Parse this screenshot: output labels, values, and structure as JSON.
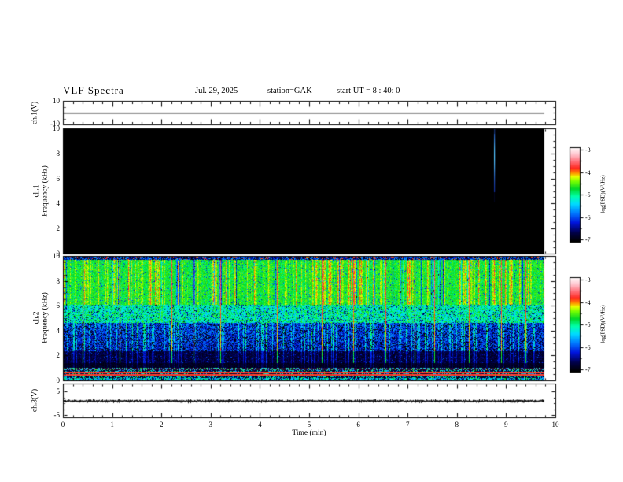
{
  "title": {
    "main": "VLF Spectra",
    "date": "Jul. 29, 2025",
    "station": "station=GAK",
    "start_ut": "start UT =  8 : 40: 0"
  },
  "x_axis": {
    "label": "Time (min)",
    "tick_labels": [
      "0",
      "1",
      "2",
      "3",
      "4",
      "5",
      "6",
      "7",
      "8",
      "9",
      "10"
    ],
    "range_min": [
      0,
      10
    ],
    "minor_step_min": 0.2,
    "data_end_min": 9.78
  },
  "colorbar": {
    "label": "log(PSD)(V²/Hz)",
    "tick_labels": [
      "-3",
      "-4",
      "-5",
      "-6",
      "-7"
    ],
    "range": [
      -7,
      -3
    ],
    "minor_step": 0.5,
    "colormap_stops": [
      [
        0.0,
        0,
        0,
        0
      ],
      [
        0.09,
        0,
        0,
        70
      ],
      [
        0.2,
        0,
        20,
        220
      ],
      [
        0.3,
        0,
        120,
        255
      ],
      [
        0.4,
        0,
        220,
        255
      ],
      [
        0.48,
        0,
        255,
        170
      ],
      [
        0.56,
        0,
        215,
        40
      ],
      [
        0.64,
        120,
        255,
        0
      ],
      [
        0.69,
        235,
        255,
        0
      ],
      [
        0.73,
        255,
        140,
        0
      ],
      [
        0.78,
        255,
        40,
        30
      ],
      [
        0.85,
        255,
        110,
        120
      ],
      [
        0.92,
        255,
        190,
        200
      ],
      [
        1.0,
        255,
        255,
        255
      ]
    ]
  },
  "chart_data": [
    {
      "id": "ch1_waveform",
      "type": "line",
      "ylabel": "ch.1(V)",
      "ylim_v": [
        -10,
        10
      ],
      "ytick_labels": [
        "10",
        "-10"
      ],
      "x_range_min": [
        0,
        9.78
      ],
      "signal": {
        "shape": "flat",
        "mean_v": 0,
        "color": "#3f3f3f"
      }
    },
    {
      "id": "ch1_spectrogram",
      "type": "heatmap",
      "ylabel_lines": [
        "ch.1",
        "Frequency (kHz)"
      ],
      "ylim_khz": [
        0,
        10
      ],
      "ytick_labels": [
        "10",
        "8",
        "6",
        "4",
        "2",
        "0"
      ],
      "ytick_minor_khz": 0.5,
      "background_log_psd": -7,
      "features": [
        {
          "type": "vertical_burst",
          "time_min": 8.75,
          "freq_span_khz": [
            5.0,
            10
          ],
          "peak_freq_khz": 7.8,
          "faint_tail_khz": [
            4.2,
            5.0
          ],
          "color": "blue-cyan"
        }
      ]
    },
    {
      "id": "ch2_spectrogram",
      "type": "heatmap",
      "ylabel_lines": [
        "ch.2",
        "Frequency (kHz)"
      ],
      "ylim_khz": [
        0,
        10
      ],
      "ytick_labels": [
        "10",
        "8",
        "6",
        "4",
        "2",
        "0"
      ],
      "ytick_minor_khz": 0.5,
      "bands": [
        {
          "freq_khz": [
            9.72,
            10.0
          ],
          "mean_log_psd": -6.3,
          "texture": "dark_mottle_red_specks"
        },
        {
          "freq_khz": [
            6.1,
            9.72
          ],
          "mean_log_psd": -4.78,
          "texture": "green_yellow_streaks"
        },
        {
          "freq_khz": [
            4.6,
            6.1
          ],
          "mean_log_psd": -5.15,
          "texture": "green_cyan_mottle"
        },
        {
          "freq_khz": [
            2.3,
            4.6
          ],
          "mean_log_psd": -6.05,
          "texture": "blue_cyan_mottle"
        },
        {
          "freq_khz": [
            1.35,
            2.3
          ],
          "mean_log_psd": -6.75,
          "texture": "dark_blue_sparse"
        },
        {
          "freq_khz": [
            1.0,
            1.35
          ],
          "mean_log_psd": -6.85,
          "texture": "near_black"
        },
        {
          "freq_khz": [
            0.0,
            1.0
          ],
          "mean_log_psd": -5.8,
          "texture": "striped",
          "red_line_freqs_khz": [
            0.88,
            0.62,
            0.42
          ]
        }
      ],
      "red_streak_times_min": [
        0.4,
        1.15,
        2.2,
        2.65,
        3.2,
        4.35,
        5.25,
        5.9,
        6.55,
        7.15,
        7.55,
        8.25,
        8.9,
        9.4
      ]
    },
    {
      "id": "ch3_waveform",
      "type": "line",
      "ylabel": "ch.3(V)",
      "ylim_v": [
        8.3,
        -6
      ],
      "ytick_labels": [
        "5",
        "-5"
      ],
      "x_range_min": [
        0,
        9.78
      ],
      "signal": {
        "shape": "flat_noisy_thick",
        "mean_v": 0.8,
        "color": "#000000"
      }
    }
  ]
}
